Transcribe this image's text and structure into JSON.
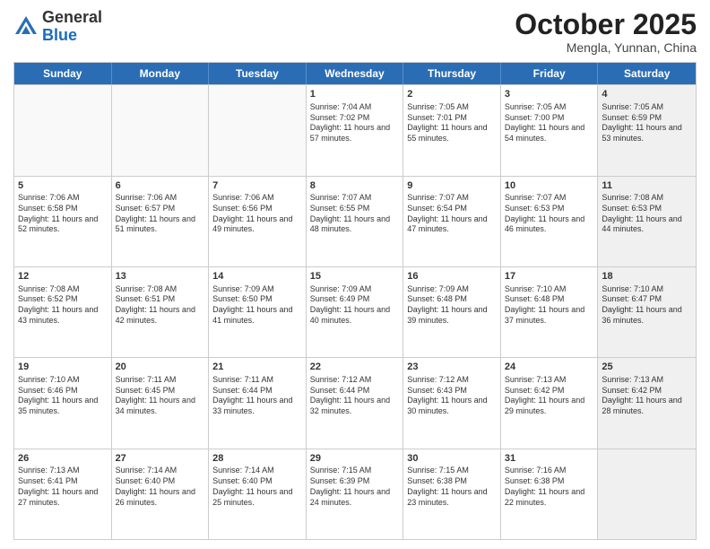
{
  "header": {
    "logo_general": "General",
    "logo_blue": "Blue",
    "month": "October 2025",
    "location": "Mengla, Yunnan, China"
  },
  "days_of_week": [
    "Sunday",
    "Monday",
    "Tuesday",
    "Wednesday",
    "Thursday",
    "Friday",
    "Saturday"
  ],
  "weeks": [
    [
      {
        "day": "",
        "text": "",
        "empty": true
      },
      {
        "day": "",
        "text": "",
        "empty": true
      },
      {
        "day": "",
        "text": "",
        "empty": true
      },
      {
        "day": "1",
        "text": "Sunrise: 7:04 AM\nSunset: 7:02 PM\nDaylight: 11 hours and 57 minutes."
      },
      {
        "day": "2",
        "text": "Sunrise: 7:05 AM\nSunset: 7:01 PM\nDaylight: 11 hours and 55 minutes."
      },
      {
        "day": "3",
        "text": "Sunrise: 7:05 AM\nSunset: 7:00 PM\nDaylight: 11 hours and 54 minutes."
      },
      {
        "day": "4",
        "text": "Sunrise: 7:05 AM\nSunset: 6:59 PM\nDaylight: 11 hours and 53 minutes.",
        "shaded": true
      }
    ],
    [
      {
        "day": "5",
        "text": "Sunrise: 7:06 AM\nSunset: 6:58 PM\nDaylight: 11 hours and 52 minutes."
      },
      {
        "day": "6",
        "text": "Sunrise: 7:06 AM\nSunset: 6:57 PM\nDaylight: 11 hours and 51 minutes."
      },
      {
        "day": "7",
        "text": "Sunrise: 7:06 AM\nSunset: 6:56 PM\nDaylight: 11 hours and 49 minutes."
      },
      {
        "day": "8",
        "text": "Sunrise: 7:07 AM\nSunset: 6:55 PM\nDaylight: 11 hours and 48 minutes."
      },
      {
        "day": "9",
        "text": "Sunrise: 7:07 AM\nSunset: 6:54 PM\nDaylight: 11 hours and 47 minutes."
      },
      {
        "day": "10",
        "text": "Sunrise: 7:07 AM\nSunset: 6:53 PM\nDaylight: 11 hours and 46 minutes."
      },
      {
        "day": "11",
        "text": "Sunrise: 7:08 AM\nSunset: 6:53 PM\nDaylight: 11 hours and 44 minutes.",
        "shaded": true
      }
    ],
    [
      {
        "day": "12",
        "text": "Sunrise: 7:08 AM\nSunset: 6:52 PM\nDaylight: 11 hours and 43 minutes."
      },
      {
        "day": "13",
        "text": "Sunrise: 7:08 AM\nSunset: 6:51 PM\nDaylight: 11 hours and 42 minutes."
      },
      {
        "day": "14",
        "text": "Sunrise: 7:09 AM\nSunset: 6:50 PM\nDaylight: 11 hours and 41 minutes."
      },
      {
        "day": "15",
        "text": "Sunrise: 7:09 AM\nSunset: 6:49 PM\nDaylight: 11 hours and 40 minutes."
      },
      {
        "day": "16",
        "text": "Sunrise: 7:09 AM\nSunset: 6:48 PM\nDaylight: 11 hours and 39 minutes."
      },
      {
        "day": "17",
        "text": "Sunrise: 7:10 AM\nSunset: 6:48 PM\nDaylight: 11 hours and 37 minutes."
      },
      {
        "day": "18",
        "text": "Sunrise: 7:10 AM\nSunset: 6:47 PM\nDaylight: 11 hours and 36 minutes.",
        "shaded": true
      }
    ],
    [
      {
        "day": "19",
        "text": "Sunrise: 7:10 AM\nSunset: 6:46 PM\nDaylight: 11 hours and 35 minutes."
      },
      {
        "day": "20",
        "text": "Sunrise: 7:11 AM\nSunset: 6:45 PM\nDaylight: 11 hours and 34 minutes."
      },
      {
        "day": "21",
        "text": "Sunrise: 7:11 AM\nSunset: 6:44 PM\nDaylight: 11 hours and 33 minutes."
      },
      {
        "day": "22",
        "text": "Sunrise: 7:12 AM\nSunset: 6:44 PM\nDaylight: 11 hours and 32 minutes."
      },
      {
        "day": "23",
        "text": "Sunrise: 7:12 AM\nSunset: 6:43 PM\nDaylight: 11 hours and 30 minutes."
      },
      {
        "day": "24",
        "text": "Sunrise: 7:13 AM\nSunset: 6:42 PM\nDaylight: 11 hours and 29 minutes."
      },
      {
        "day": "25",
        "text": "Sunrise: 7:13 AM\nSunset: 6:42 PM\nDaylight: 11 hours and 28 minutes.",
        "shaded": true
      }
    ],
    [
      {
        "day": "26",
        "text": "Sunrise: 7:13 AM\nSunset: 6:41 PM\nDaylight: 11 hours and 27 minutes."
      },
      {
        "day": "27",
        "text": "Sunrise: 7:14 AM\nSunset: 6:40 PM\nDaylight: 11 hours and 26 minutes."
      },
      {
        "day": "28",
        "text": "Sunrise: 7:14 AM\nSunset: 6:40 PM\nDaylight: 11 hours and 25 minutes."
      },
      {
        "day": "29",
        "text": "Sunrise: 7:15 AM\nSunset: 6:39 PM\nDaylight: 11 hours and 24 minutes."
      },
      {
        "day": "30",
        "text": "Sunrise: 7:15 AM\nSunset: 6:38 PM\nDaylight: 11 hours and 23 minutes."
      },
      {
        "day": "31",
        "text": "Sunrise: 7:16 AM\nSunset: 6:38 PM\nDaylight: 11 hours and 22 minutes."
      },
      {
        "day": "",
        "text": "",
        "empty": true,
        "shaded": true
      }
    ]
  ]
}
